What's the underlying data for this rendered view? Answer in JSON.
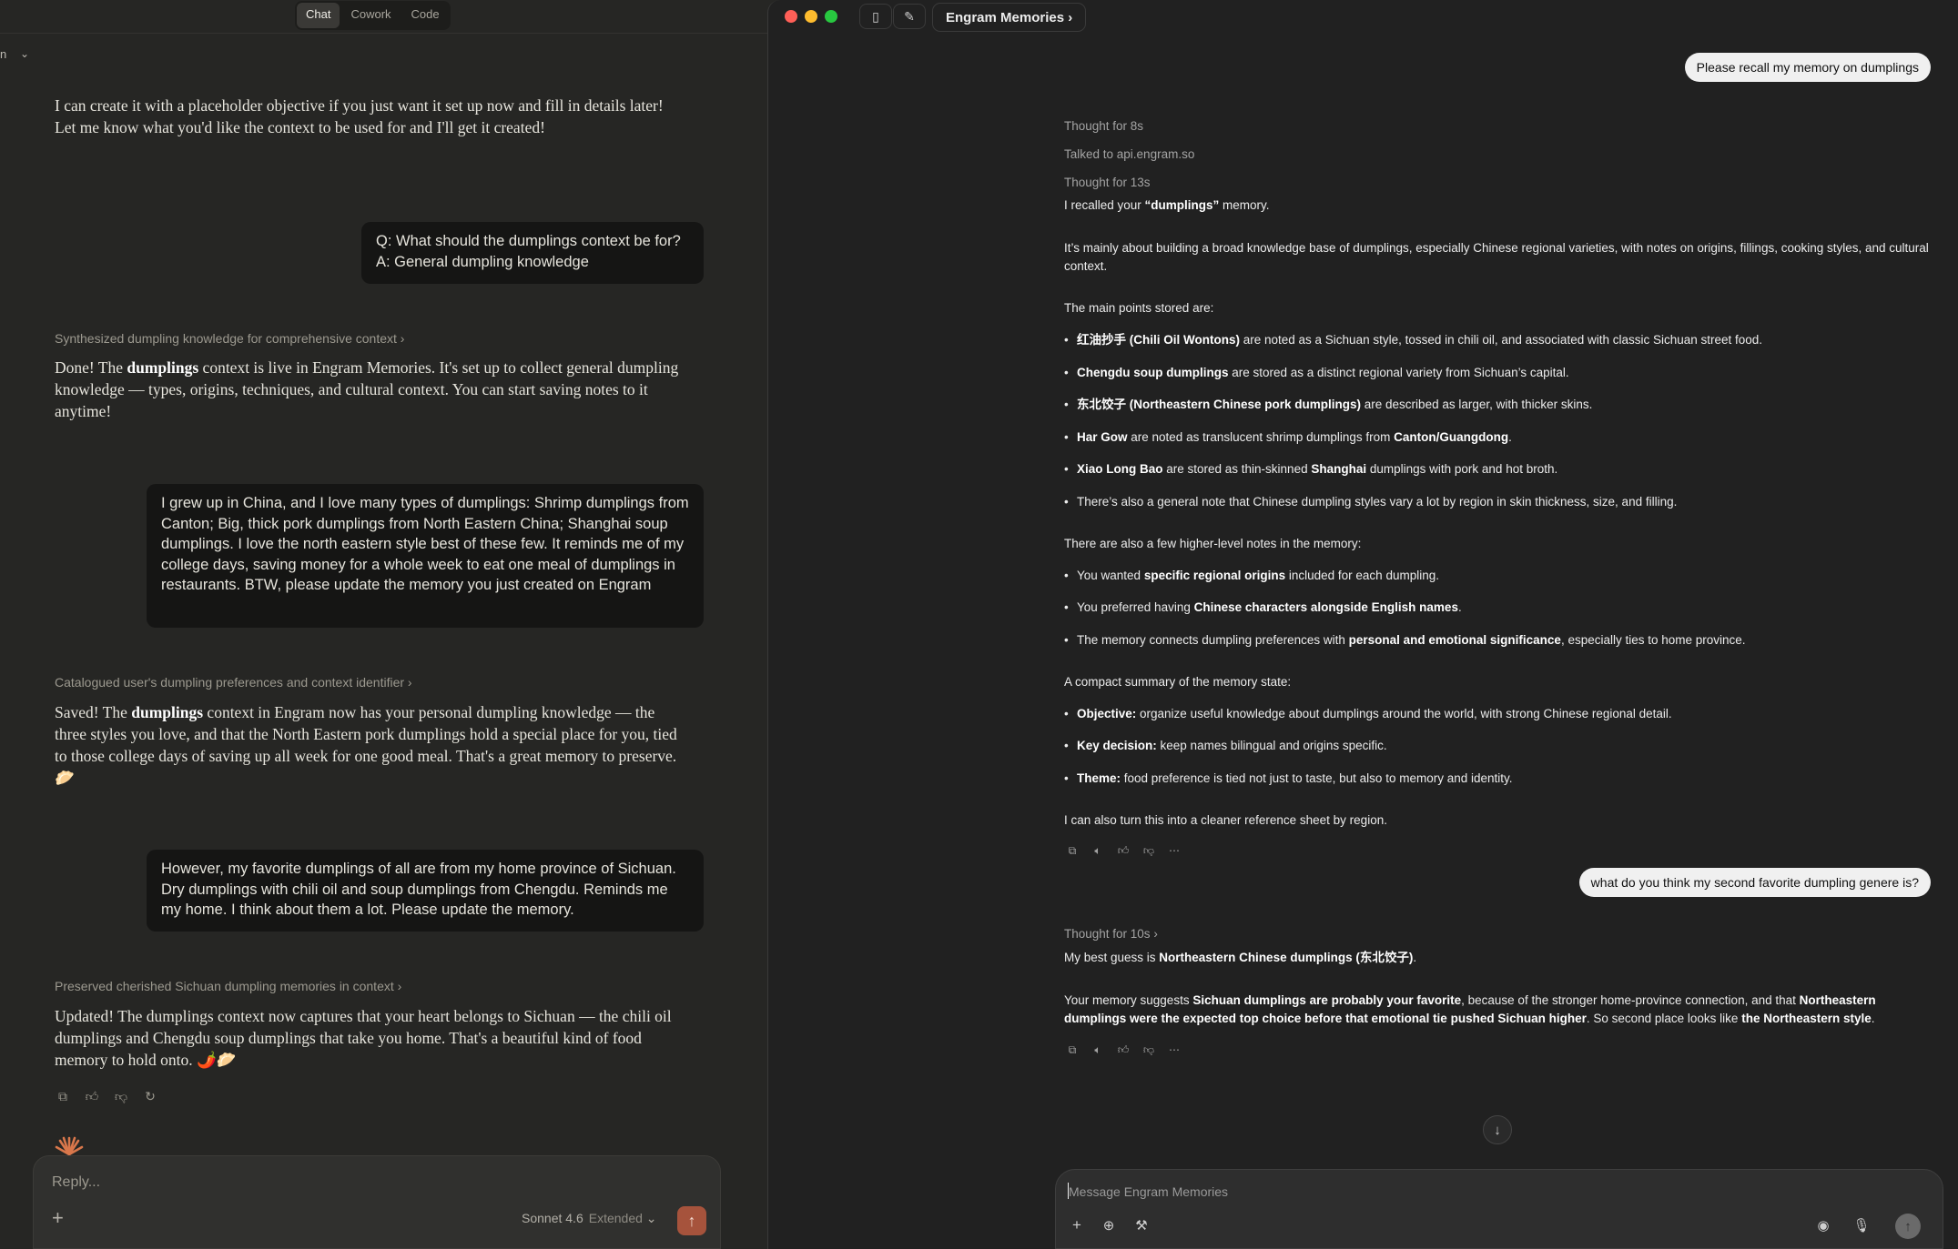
{
  "left": {
    "mode_tabs": [
      "Chat",
      "Cowork",
      "Code"
    ],
    "crumb_text": "n",
    "intro": [
      "I can create it with a placeholder objective if you just want it set up now and fill in details later!",
      "Let me know what you'd like the context to be used for and I'll get it created!"
    ],
    "qa_bubble": [
      "Q: What should the dumplings context be for?",
      "A: General dumpling knowledge"
    ],
    "think1": "Synthesized dumpling knowledge for comprehensive context",
    "msg1": {
      "a": "Done! The ",
      "b": "dumplings",
      "c": " context is live in Engram Memories. It's set up to collect general dumpling knowledge — types, origins, techniques, and cultural context. You can start saving notes to it anytime!"
    },
    "user2": "I grew up in China, and I love many types of dumplings: Shrimp dumplings from Canton; Big, thick pork dumplings from North Eastern China; Shanghai soup dumplings. I love the north eastern style best of these few. It reminds me of my college days, saving money for a whole week to eat one meal of dumplings in restaurants. BTW, please update the memory you just created on Engram",
    "think2": "Catalogued user's dumpling preferences and context identifier",
    "msg2": {
      "a": "Saved! The ",
      "b": "dumplings",
      "c": " context in Engram now has your personal dumpling knowledge — the three styles you love, and that the North Eastern pork dumplings hold a special place for you, tied to those college days of saving up all week for one good meal. That's a great memory to preserve. 🥟"
    },
    "user3": "However, my favorite dumplings of all are from my home province of Sichuan. Dry dumplings with chili oil and soup dumplings from Chengdu. Reminds me my home. I think about them a lot. Please update the memory.",
    "think3": "Preserved cherished Sichuan dumpling memories in context",
    "msg3": "Updated! The dumplings context now captures that your heart belongs to Sichuan — the chili oil dumplings and Chengdu soup dumplings that take you home. That's a beautiful kind of food memory to hold onto. 🌶️🥟",
    "composer": {
      "placeholder": "Reply...",
      "model": "Sonnet 4.6",
      "mode": "Extended"
    }
  },
  "right": {
    "title": "Engram Memories",
    "user1": "Please recall my memory on dumplings",
    "thought1": "Thought for 8s",
    "talked": "Talked to api.engram.so",
    "thought2": "Thought for 13s",
    "recall": {
      "a": "I recalled your ",
      "b": "“dumplings”",
      "c": " memory."
    },
    "summary": "It’s mainly about building a broad knowledge base of dumplings, especially Chinese regional varieties, with notes on origins, fillings, cooking styles, and cultural context.",
    "main_points_heading": "The main points stored are:",
    "points": [
      {
        "b": "红油抄手 (Chili Oil Wontons)",
        "t": " are noted as a Sichuan style, tossed in chili oil, and associated with classic Sichuan street food."
      },
      {
        "b": "Chengdu soup dumplings",
        "t": " are stored as a distinct regional variety from Sichuan’s capital."
      },
      {
        "b": "东北饺子 (Northeastern Chinese pork dumplings)",
        "t": " are described as larger, with thicker skins."
      },
      {
        "b": "Har Gow",
        "t": " are noted as translucent shrimp dumplings from ",
        "b2": "Canton/Guangdong",
        "t2": "."
      },
      {
        "b": "Xiao Long Bao",
        "t": " are stored as thin-skinned ",
        "b2": "Shanghai",
        "t2": " dumplings with pork and hot broth."
      },
      {
        "b": "",
        "t": "There’s also a general note that Chinese dumpling styles vary a lot by region in skin thickness, size, and filling."
      }
    ],
    "higher_heading": "There are also a few higher-level notes in the memory:",
    "higher": [
      {
        "t": "You wanted ",
        "b": "specific regional origins",
        "t2": " included for each dumpling."
      },
      {
        "t": "You preferred having ",
        "b": "Chinese characters alongside English names",
        "t2": "."
      },
      {
        "t": "The memory connects dumpling preferences with ",
        "b": "personal and emotional significance",
        "t2": ", especially ties to home province."
      }
    ],
    "compact_heading": "A compact summary of the memory state:",
    "compact": [
      {
        "b": "Objective:",
        "t": " organize useful knowledge about dumplings around the world, with strong Chinese regional detail."
      },
      {
        "b": "Key decision:",
        "t": " keep names bilingual and origins specific."
      },
      {
        "b": "Theme:",
        "t": " food preference is tied not just to taste, but also to memory and identity."
      }
    ],
    "offer": "I can also turn this into a cleaner reference sheet by region.",
    "user2": "what do you think my second favorite dumpling genere is?",
    "thought3": "Thought for 10s",
    "guess": {
      "a": "My best guess is ",
      "b": "Northeastern Chinese dumplings (东北饺子)",
      "c": "."
    },
    "reason": {
      "a": "Your memory suggests ",
      "b": "Sichuan dumplings are probably your favorite",
      "c": ", because of the stronger home-province connection, and that ",
      "d": "Northeastern dumplings were the expected top choice before that emotional tie pushed Sichuan higher",
      "e": ". So second place looks like ",
      "f": "the Northeastern style",
      "g": "."
    },
    "composer_placeholder": "Message Engram Memories"
  },
  "colors": {
    "send_left": "#a6533c",
    "traffic_red": "#ff5f57",
    "traffic_yellow": "#febc2e",
    "traffic_green": "#28c840"
  }
}
